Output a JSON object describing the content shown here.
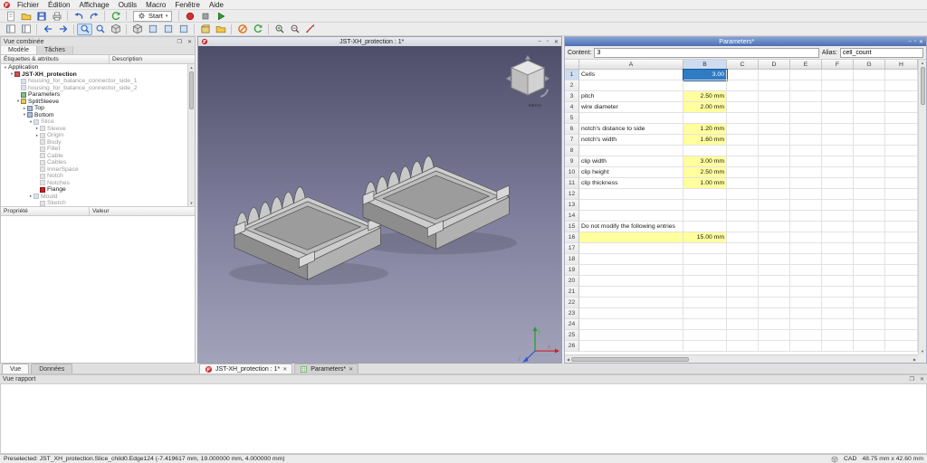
{
  "window": {
    "buttons": {
      "min": "–",
      "max": "▫",
      "close": "✕",
      "float": "❐"
    },
    "glyphs": {
      "up": "▲",
      "down": "▼",
      "left": "◀",
      "right": "▶"
    }
  },
  "menu": {
    "items": [
      "Fichier",
      "Édition",
      "Affichage",
      "Outils",
      "Macro",
      "Fenêtre",
      "Aide"
    ]
  },
  "toolbars": {
    "workbench_selector": {
      "label": "Start",
      "caret": "▾"
    },
    "row1": [
      {
        "name": "new-document",
        "icon": "page"
      },
      {
        "name": "open-document",
        "icon": "folder"
      },
      {
        "name": "save-document",
        "icon": "save"
      },
      {
        "name": "print-document",
        "icon": "print"
      },
      {
        "sep": true
      },
      {
        "name": "undo",
        "icon": "undo"
      },
      {
        "name": "redo",
        "icon": "redo"
      },
      {
        "sep": true
      },
      {
        "name": "refresh-document",
        "icon": "refresh"
      },
      {
        "sep": true
      },
      {
        "name": "workbench-selector",
        "type": "dropdown",
        "icon": "gear"
      },
      {
        "sep": true
      },
      {
        "name": "macro-record",
        "icon": "record"
      },
      {
        "name": "macro-stop",
        "icon": "stop"
      },
      {
        "name": "macro-execute",
        "icon": "play"
      }
    ],
    "row2": [
      {
        "name": "toggle-combo-view",
        "icon": "panel"
      },
      {
        "name": "toggle-report-view",
        "icon": "panel"
      },
      {
        "sep": true
      },
      {
        "name": "nav-back",
        "icon": "arrowL"
      },
      {
        "name": "nav-forward",
        "icon": "arrowR"
      },
      {
        "sep": true
      },
      {
        "name": "fit-all",
        "icon": "magnifier",
        "active": true
      },
      {
        "name": "fit-selection",
        "icon": "magnifier"
      },
      {
        "name": "draw-style",
        "icon": "cube"
      },
      {
        "sep": true
      },
      {
        "name": "view-isometric",
        "icon": "cube"
      },
      {
        "name": "view-front",
        "icon": "square"
      },
      {
        "name": "view-top",
        "icon": "square"
      },
      {
        "name": "view-right",
        "icon": "square"
      },
      {
        "sep": true
      },
      {
        "name": "create-box",
        "icon": "box"
      },
      {
        "name": "create-group",
        "icon": "folder"
      },
      {
        "sep": true
      },
      {
        "name": "stop-loading",
        "icon": "stopOrange"
      },
      {
        "name": "refresh-view",
        "icon": "refresh"
      },
      {
        "sep": true
      },
      {
        "name": "zoom-in",
        "icon": "zoomIn"
      },
      {
        "name": "zoom-out",
        "icon": "zoomOut"
      },
      {
        "name": "measure-distance",
        "icon": "measure"
      }
    ]
  },
  "left_dock": {
    "title": "Vue combinée",
    "tabs": [
      {
        "label": "Modèle",
        "active": true
      },
      {
        "label": "Tâches"
      }
    ],
    "columns": [
      "Étiquettes & attributs",
      "Description"
    ],
    "tree": [
      {
        "label": "Application",
        "depth": 0,
        "exp": "open"
      },
      {
        "label": "JST-XH_protection",
        "depth": 1,
        "bold": true,
        "exp": "open",
        "icon": "doc"
      },
      {
        "label": "housing_for_balance_connector_side_1",
        "depth": 2,
        "dim": true,
        "icon": "part"
      },
      {
        "label": "housing_for_balance_connector_side_2",
        "depth": 2,
        "dim": true,
        "icon": "part"
      },
      {
        "label": "Parameters",
        "depth": 2,
        "icon": "sheet"
      },
      {
        "label": "SplitSleeve",
        "depth": 2,
        "exp": "open",
        "icon": "folder"
      },
      {
        "label": "Top",
        "depth": 3,
        "exp": "closed",
        "icon": "part"
      },
      {
        "label": "Bottom",
        "depth": 3,
        "exp": "open",
        "icon": "part"
      },
      {
        "label": "Slice",
        "depth": 4,
        "exp": "open",
        "dim": true,
        "icon": "part"
      },
      {
        "label": "Sleeve",
        "depth": 5,
        "exp": "closed",
        "dim": true,
        "icon": "gray"
      },
      {
        "label": "Origin",
        "depth": 5,
        "exp": "closed",
        "dim": true,
        "icon": "gray"
      },
      {
        "label": "Body",
        "depth": 5,
        "dim": true,
        "icon": "gray"
      },
      {
        "label": "Fillet",
        "depth": 5,
        "dim": true,
        "icon": "gray"
      },
      {
        "label": "Cable",
        "depth": 5,
        "dim": true,
        "icon": "gray"
      },
      {
        "label": "Cables",
        "depth": 5,
        "dim": true,
        "icon": "gray"
      },
      {
        "label": "InnerSpace",
        "depth": 5,
        "dim": true,
        "icon": "gray"
      },
      {
        "label": "Notch",
        "depth": 5,
        "dim": true,
        "icon": "gray"
      },
      {
        "label": "Notches",
        "depth": 5,
        "dim": true,
        "icon": "gray"
      },
      {
        "label": "Flange",
        "depth": 5,
        "icon": "red"
      },
      {
        "label": "Mould",
        "depth": 4,
        "exp": "closed",
        "dim": true,
        "icon": "part"
      },
      {
        "label": "Sketch",
        "depth": 5,
        "dim": true,
        "icon": "gray"
      }
    ],
    "property_columns": [
      "Propriété",
      "Valeur"
    ],
    "bottom_tabs": [
      {
        "label": "Vue",
        "active": true
      },
      {
        "label": "Données"
      }
    ]
  },
  "viewport": {
    "title": "JST-XH_protection : 1*",
    "nav_menu_label": "MENU",
    "axis_labels": {
      "x": "x",
      "y": "y",
      "z": "z"
    }
  },
  "spreadsheet": {
    "title": "Parameters*",
    "content_label": "Content:",
    "content_value": "3",
    "alias_label": "Alias:",
    "alias_value": "cell_count",
    "columns": [
      "A",
      "B",
      "C",
      "D",
      "E",
      "F",
      "G",
      "H"
    ],
    "rows": [
      {
        "n": 1,
        "cells": {
          "A": "Cells",
          "B": "3.00"
        },
        "styles": {
          "B": "selected"
        }
      },
      {
        "n": 2
      },
      {
        "n": 3,
        "cells": {
          "A": "pitch",
          "B": "2.50 mm"
        },
        "styles": {
          "B": "yellow"
        }
      },
      {
        "n": 4,
        "cells": {
          "A": "wire diameter",
          "B": "2.00 mm"
        },
        "styles": {
          "B": "yellow"
        }
      },
      {
        "n": 5
      },
      {
        "n": 6,
        "cells": {
          "A": "notch's distance to side",
          "B": "1.20 mm"
        },
        "styles": {
          "B": "yellow"
        }
      },
      {
        "n": 7,
        "cells": {
          "A": "notch's width",
          "B": "1.60 mm"
        },
        "styles": {
          "B": "yellow"
        }
      },
      {
        "n": 8
      },
      {
        "n": 9,
        "cells": {
          "A": "clip width",
          "B": "3.00 mm"
        },
        "styles": {
          "B": "yellow"
        }
      },
      {
        "n": 10,
        "cells": {
          "A": "clip height",
          "B": "2.50 mm"
        },
        "styles": {
          "B": "yellow"
        }
      },
      {
        "n": 11,
        "cells": {
          "A": "clip thickness",
          "B": "1.00 mm"
        },
        "styles": {
          "B": "yellow"
        }
      },
      {
        "n": 12
      },
      {
        "n": 13
      },
      {
        "n": 14
      },
      {
        "n": 15,
        "cells": {
          "A": "Do not modify the following entries"
        }
      },
      {
        "n": 16,
        "cells": {
          "B": "15.00 mm"
        },
        "styles": {
          "A": "yellow",
          "B": "yellow"
        }
      },
      {
        "n": 17
      },
      {
        "n": 18
      },
      {
        "n": 19
      },
      {
        "n": 20
      },
      {
        "n": 21
      },
      {
        "n": 22
      },
      {
        "n": 23
      },
      {
        "n": 24
      },
      {
        "n": 25
      },
      {
        "n": 26
      }
    ]
  },
  "mdi": {
    "close_glyph": "✕",
    "tabs": [
      {
        "label": "JST-XH_protection : 1*",
        "icon": "fclogo",
        "active": true
      },
      {
        "label": "Parameters*",
        "icon": "sheet"
      }
    ]
  },
  "report": {
    "title": "Vue rapport"
  },
  "status": {
    "message": "Preselected: JST_XH_protection.Slice_child0.Edge124 (-7.419617 mm, 19.000000 mm, 4.000000 mm)",
    "nav_style": "CAD",
    "dimensions": "48.75 mm x 42.60 mm"
  }
}
